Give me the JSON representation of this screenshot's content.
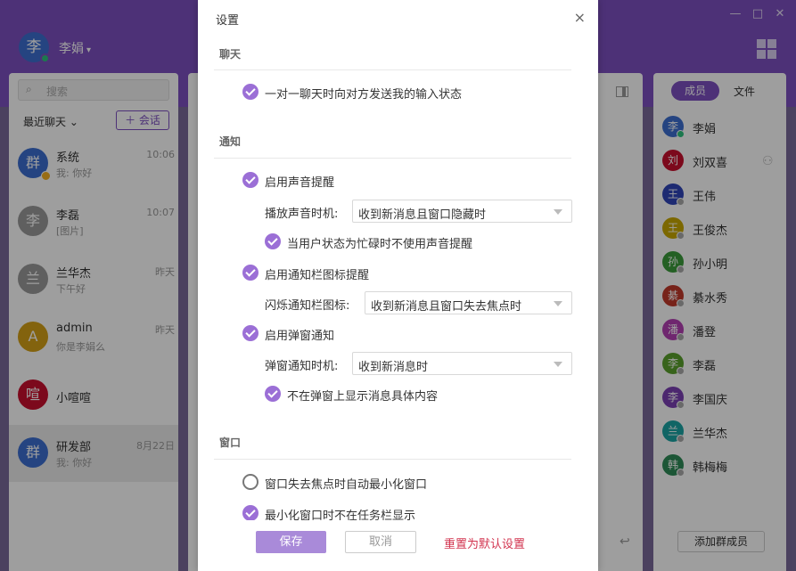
{
  "app": {
    "user_name": "李娟",
    "user_avatar_char": "李",
    "caret": "▾",
    "search_placeholder": "搜索",
    "search_icon": "search-icon",
    "recent_label": "最近聊天 ⌄",
    "new_session_label": "＋ 会话",
    "accent_color": "#7c4fc0"
  },
  "sessions": [
    {
      "avatar": "群",
      "name": "系统",
      "time": "10:06",
      "msg": "我: 你好",
      "color": "#3d6fd0"
    },
    {
      "avatar": "李",
      "name": "李磊",
      "time": "10:07",
      "msg": "[图片]",
      "color": "#9a9a9a"
    },
    {
      "avatar": "兰",
      "name": "兰华杰",
      "time": "昨天",
      "msg": "下午好",
      "color": "#9a9a9a"
    },
    {
      "avatar": "A",
      "name": "admin",
      "time": "昨天",
      "msg": "你是李娟么",
      "color": "#d4a017"
    },
    {
      "avatar": "喧",
      "name": "小喧喧",
      "time": "",
      "msg": "",
      "color": "#c8102e"
    },
    {
      "avatar": "群",
      "name": "研发部",
      "time": "8月22日",
      "msg": "我: 你好",
      "color": "#3d6fd0"
    }
  ],
  "members_tab": {
    "members": "成员",
    "files": "文件",
    "add_member": "添加群成员"
  },
  "members": [
    {
      "avatar": "李",
      "name": "李娟",
      "color": "#3d6fd0",
      "status": "#2ec27e"
    },
    {
      "avatar": "刘",
      "name": "刘双喜",
      "color": "#c8102e",
      "status": ""
    },
    {
      "avatar": "王",
      "name": "王伟",
      "color": "#2f45b8",
      "status": "#aaaaaa"
    },
    {
      "avatar": "王",
      "name": "王俊杰",
      "color": "#c9a800",
      "status": "#aaaaaa"
    },
    {
      "avatar": "孙",
      "name": "孙小明",
      "color": "#3a9b3a",
      "status": "#aaaaaa"
    },
    {
      "avatar": "綦",
      "name": "綦水秀",
      "color": "#c0392b",
      "status": "#aaaaaa"
    },
    {
      "avatar": "潘",
      "name": "潘登",
      "color": "#b33fb3",
      "status": "#aaaaaa"
    },
    {
      "avatar": "李",
      "name": "李磊",
      "color": "#5aa02c",
      "status": "#aaaaaa"
    },
    {
      "avatar": "李",
      "name": "李国庆",
      "color": "#7b3fb3",
      "status": "#aaaaaa"
    },
    {
      "avatar": "兰",
      "name": "兰华杰",
      "color": "#1aa3a3",
      "status": "#aaaaaa"
    },
    {
      "avatar": "韩",
      "name": "韩梅梅",
      "color": "#2e8b57",
      "status": "#aaaaaa"
    }
  ],
  "dialog": {
    "title": "设置",
    "close": "×",
    "sections": {
      "chat": "聊天",
      "notify": "通知",
      "window": "窗口"
    },
    "chat_typing": "一对一聊天时向对方发送我的输入状态",
    "sound_enable": "启用声音提醒",
    "sound_timing_label": "播放声音时机:",
    "sound_timing_value": "收到新消息且窗口隐藏时",
    "sound_busy": "当用户状态为忙碌时不使用声音提醒",
    "tray_enable": "启用通知栏图标提醒",
    "tray_flash_label": "闪烁通知栏图标:",
    "tray_flash_value": "收到新消息且窗口失去焦点时",
    "popup_enable": "启用弹窗通知",
    "popup_timing_label": "弹窗通知时机:",
    "popup_timing_value": "收到新消息时",
    "popup_hide_content": "不在弹窗上显示消息具体内容",
    "window_minimize": "窗口失去焦点时自动最小化窗口",
    "window_taskbar": "最小化窗口时不在任务栏显示",
    "save": "保存",
    "cancel": "取消",
    "reset": "重置为默认设置"
  }
}
